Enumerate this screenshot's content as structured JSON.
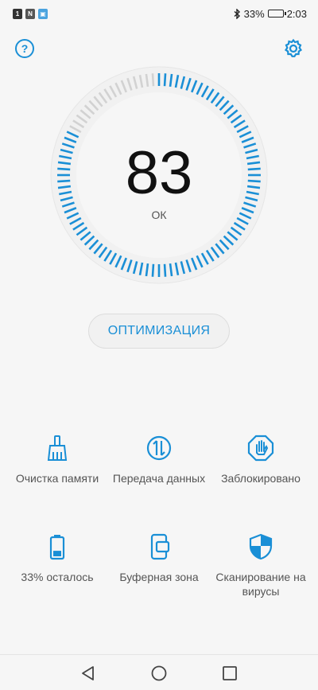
{
  "status_bar": {
    "battery_text": "33%",
    "battery_level": 0.33,
    "time": "2:03",
    "icons": [
      "sim-icon",
      "nfc-icon",
      "app-notification-icon",
      "bluetooth-icon",
      "battery-icon"
    ]
  },
  "header": {
    "help_label": "?",
    "icons": [
      "help-icon",
      "gear-icon"
    ]
  },
  "gauge": {
    "score": "83",
    "score_value": 83,
    "status": "ОК"
  },
  "optimize_button": "ОПТИМИЗАЦИЯ",
  "tiles": [
    {
      "label": "Очистка памяти",
      "icon": "broom-icon"
    },
    {
      "label": "Передача данных",
      "icon": "data-transfer-icon"
    },
    {
      "label": "Заблокировано",
      "icon": "blocked-hand-icon"
    },
    {
      "label": "33% осталось",
      "icon": "battery-icon"
    },
    {
      "label": "Буферная зона",
      "icon": "phone-buffer-icon"
    },
    {
      "label": "Сканирование на вирусы",
      "icon": "shield-icon"
    }
  ],
  "navigation": {
    "icons": [
      "back-icon",
      "home-icon",
      "recents-icon"
    ]
  },
  "colors": {
    "accent": "#1a8fd6",
    "gauge_inactive": "#d2d2d2",
    "background": "#f6f6f6"
  }
}
